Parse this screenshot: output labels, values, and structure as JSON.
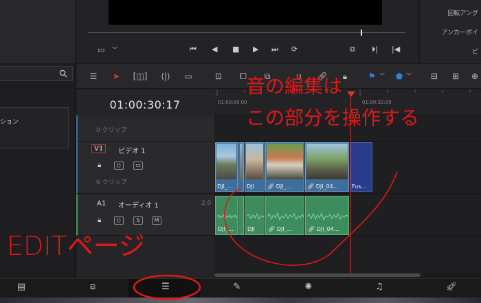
{
  "inspector": {
    "rotation_label": "回転アング",
    "anchor_label": "アンカーポイ",
    "cut_label": "ピ"
  },
  "timeline": {
    "timecode": "01:00:30:17",
    "ruler_start": "01:00:00:00",
    "ruler_mark": "01:00:32:00",
    "tracks": {
      "upper_clip_count": "0 クリップ",
      "video": {
        "code": "V1",
        "name": "ビデオ 1",
        "clip_count": "6 クリップ"
      },
      "audio": {
        "code": "A1",
        "name": "オーディオ 1",
        "channel": "2.0",
        "solo": "S",
        "mute": "M"
      }
    },
    "video_clips": [
      "DJI_...",
      "DJI",
      "DJI_...",
      "DJI_04...",
      "Fus..."
    ],
    "audio_clips": [
      "DJI_...",
      "DJI",
      "DJI_...",
      "DJI_04..."
    ]
  },
  "left_panel": {
    "item_text": "ション"
  },
  "annotations": {
    "line1": "音の編集は",
    "line2": "この部分を操作する",
    "page_label": "EDITページ"
  },
  "colors": {
    "annotation": "#e01818",
    "video_clip": "#3e6f9c",
    "audio_clip": "#3c8c5e",
    "playhead": "#d12c2c"
  },
  "icons": {
    "transport": [
      "first-frame-icon",
      "step-back-icon",
      "stop-icon",
      "play-icon",
      "last-frame-icon",
      "loop-icon"
    ],
    "pages": [
      "media-page-icon",
      "cut-page-icon",
      "edit-page-icon",
      "fusion-page-icon",
      "color-page-icon",
      "fairlight-page-icon",
      "deliver-page-icon"
    ]
  }
}
